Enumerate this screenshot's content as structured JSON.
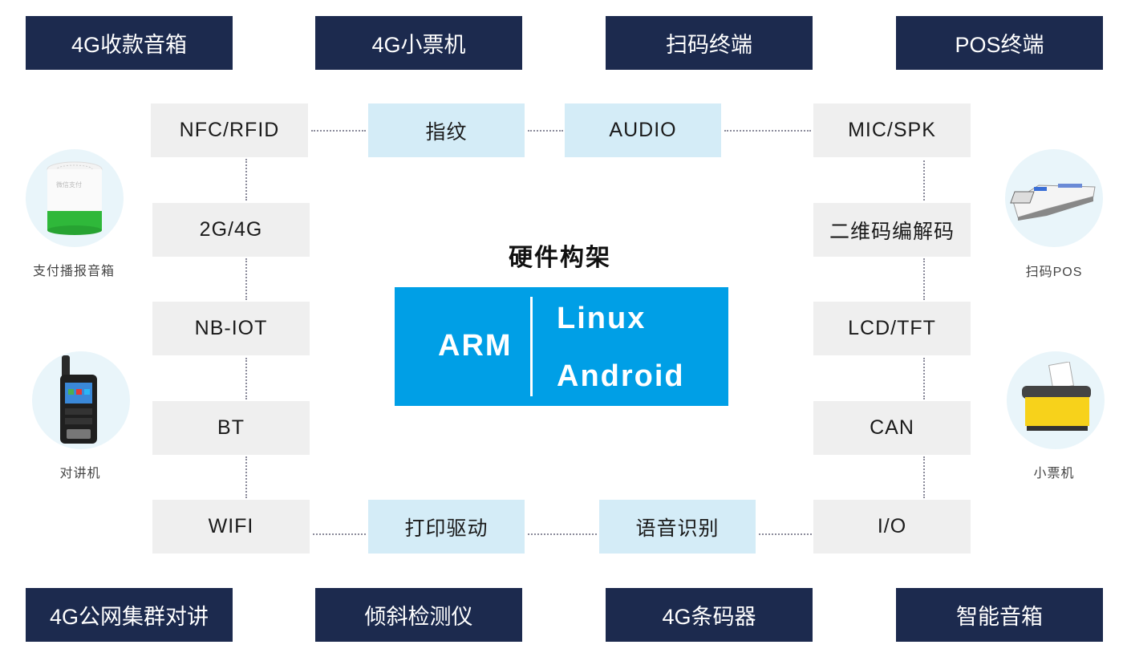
{
  "products_top": [
    "4G收款音箱",
    "4G小票机",
    "扫码终端",
    "POS终端"
  ],
  "products_bottom": [
    "4G公网集群对讲",
    "倾斜检测仪",
    "4G条码器",
    "智能音箱"
  ],
  "left_column": [
    "NFC/RFID",
    "2G/4G",
    "NB-IOT",
    "BT",
    "WIFI"
  ],
  "right_column": [
    "MIC/SPK",
    "二维码编解码",
    "LCD/TFT",
    "CAN",
    "I/O"
  ],
  "top_middle": [
    "指纹",
    "AUDIO"
  ],
  "bottom_middle": [
    "打印驱动",
    "语音识别"
  ],
  "center": {
    "title": "硬件构架",
    "cpu": "ARM",
    "os": [
      "Linux",
      "Android"
    ]
  },
  "devices": {
    "left": [
      {
        "label": "支付播报音箱",
        "icon": "speaker-device-icon"
      },
      {
        "label": "对讲机",
        "icon": "walkie-talkie-icon"
      }
    ],
    "right": [
      {
        "label": "扫码POS",
        "icon": "pos-terminal-icon"
      },
      {
        "label": "小票机",
        "icon": "receipt-printer-icon"
      }
    ]
  },
  "colors": {
    "navy": "#1c2a4e",
    "core_blue": "#009fe6",
    "light_blue": "#d4ecf7",
    "gray": "#efefef"
  }
}
